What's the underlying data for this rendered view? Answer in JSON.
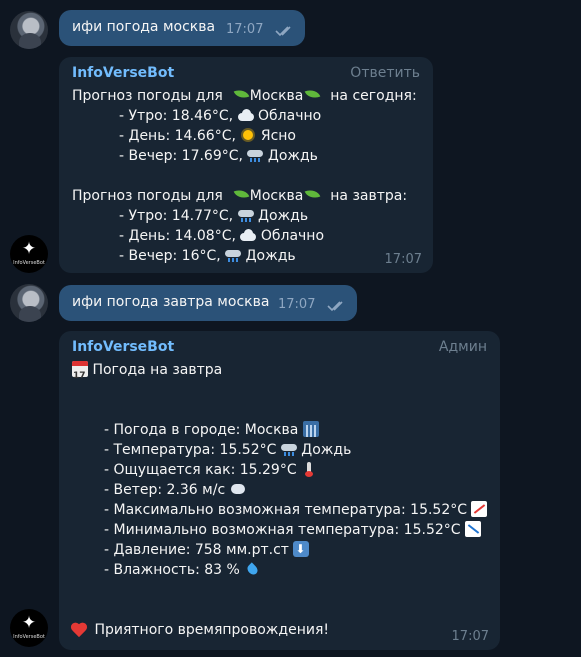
{
  "msg1": {
    "text": "ифи погода москва",
    "time": "17:07"
  },
  "bot1": {
    "author": "InfoVerseBot",
    "action": "Ответить",
    "today_pre": "Прогноз погоды для",
    "city": "Москва",
    "today_post": "на сегодня:",
    "today": [
      {
        "text": "- Утро: 18.46°C,",
        "icon": "cloud-icon",
        "cond": "Облачно"
      },
      {
        "text": "- День: 14.66°C,",
        "icon": "sun-icon",
        "cond": "Ясно"
      },
      {
        "text": "- Вечер: 17.69°C,",
        "icon": "rain-cloud-icon",
        "cond": "Дождь"
      }
    ],
    "tomorrow_pre": "Прогноз погоды для",
    "tomorrow_post": "на завтра:",
    "tomorrow": [
      {
        "text": "- Утро: 14.77°C,",
        "icon": "rain-cloud-icon",
        "cond": "Дождь"
      },
      {
        "text": "- День: 14.08°C,",
        "icon": "cloud-icon",
        "cond": "Облачно"
      },
      {
        "text": "- Вечер: 16°C,",
        "icon": "rain-cloud-icon",
        "cond": "Дождь"
      }
    ],
    "time": "17:07"
  },
  "msg2": {
    "text": "ифи погода завтра москва",
    "time": "17:07"
  },
  "bot2": {
    "author": "InfoVerseBot",
    "action": "Админ",
    "heading": "Погода на завтра",
    "details": [
      {
        "text": "- Погода в городе: Москва",
        "icon": "cityscape-icon"
      },
      {
        "text": "- Температура: 15.52°C",
        "icon": "rain-cloud-icon",
        "after": "Дождь"
      },
      {
        "text": "- Ощущается как: 15.29°C",
        "icon": "thermometer-icon"
      },
      {
        "text": "- Ветер: 2.36 м/с",
        "icon": "wind-icon"
      },
      {
        "text": "- Максимально возможная температура: 15.52°C",
        "icon": "chart-increasing-icon"
      },
      {
        "text": "- Минимально возможная температура: 15.52°C",
        "icon": "chart-decreasing-icon"
      },
      {
        "text": "- Давление: 758 мм.рт.ст",
        "icon": "down-arrow-icon"
      },
      {
        "text": "- Влажность: 83 %",
        "icon": "droplet-icon"
      }
    ],
    "farewell": "Приятного времяпровождения!",
    "time": "17:07"
  },
  "bot_avatar_label": "InfoVerseBot",
  "colors": {
    "background": "#0e1621",
    "outgoing": "#2b5278",
    "incoming": "#182533",
    "author": "#72bcfd",
    "muted": "#6d7f8f"
  }
}
